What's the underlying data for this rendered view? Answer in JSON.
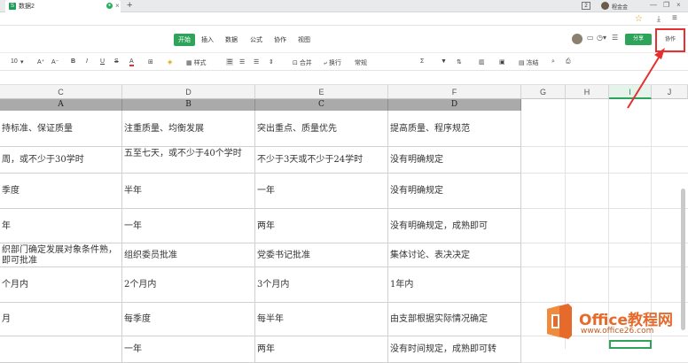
{
  "browser": {
    "tab_title": "数据2",
    "tab_icon_letter": "S",
    "tab_close": "×",
    "new_tab": "+",
    "badge": "2",
    "user_name": "程金金",
    "window_controls": [
      "—",
      "❐",
      "×"
    ],
    "star_icon": "☆",
    "download_icon": "⤓",
    "menu_icon": "≡"
  },
  "ribbon": {
    "tabs": [
      "开始",
      "插入",
      "数据",
      "公式",
      "协作",
      "视图"
    ],
    "active_tab": "开始",
    "share_label": "分享",
    "collab_label": "协作",
    "accent": "#2ea35a",
    "highlight": "#e5302f"
  },
  "toolbar": {
    "font_size": "10",
    "font_size_arrow": "▾",
    "grow": "A⁺",
    "shrink": "A⁻",
    "bold": "B",
    "italic": "I",
    "underline": "U",
    "strike": "S",
    "font_color": "A",
    "border": "⊞",
    "fill": "◈",
    "style_label": "样式",
    "merge_label": "合并",
    "wrap_label": "换行",
    "number_format": "常规",
    "sum": "Σ",
    "filter": "▼",
    "freeze_label": "冻结",
    "search": "🔍",
    "print": "⎙"
  },
  "columns": [
    "C",
    "D",
    "E",
    "F",
    "G",
    "H",
    "I",
    "J"
  ],
  "selected_column": "I",
  "header_row": [
    "A",
    "B",
    "C",
    "D"
  ],
  "rows": [
    [
      "持标准、保证质量",
      "注重质量、均衡发展",
      "突出重点、质量优先",
      "提高质量、程序规范"
    ],
    [
      "周，或不少于30学时",
      "五至七天，或不少于40个学时",
      "不少于3天或不少于24学时",
      "没有明确规定"
    ],
    [
      "季度",
      "半年",
      "一年",
      "没有明确规定"
    ],
    [
      "年",
      "一年",
      "两年",
      "没有明确规定，成熟即可"
    ],
    [
      "织部门确定发展对象条件熟，即可批准",
      "组织委员批准",
      "党委书记批准",
      "集体讨论、表决决定"
    ],
    [
      "个月内",
      "2个月内",
      "3个月内",
      "1年内"
    ],
    [
      "月",
      "每季度",
      "每半年",
      "由支部根据实际情况确定"
    ],
    [
      "",
      "一年",
      "两年",
      "没有时间规定，成熟即可转"
    ]
  ],
  "watermark": {
    "title": "Office教程网",
    "url": "www.office26.com"
  }
}
